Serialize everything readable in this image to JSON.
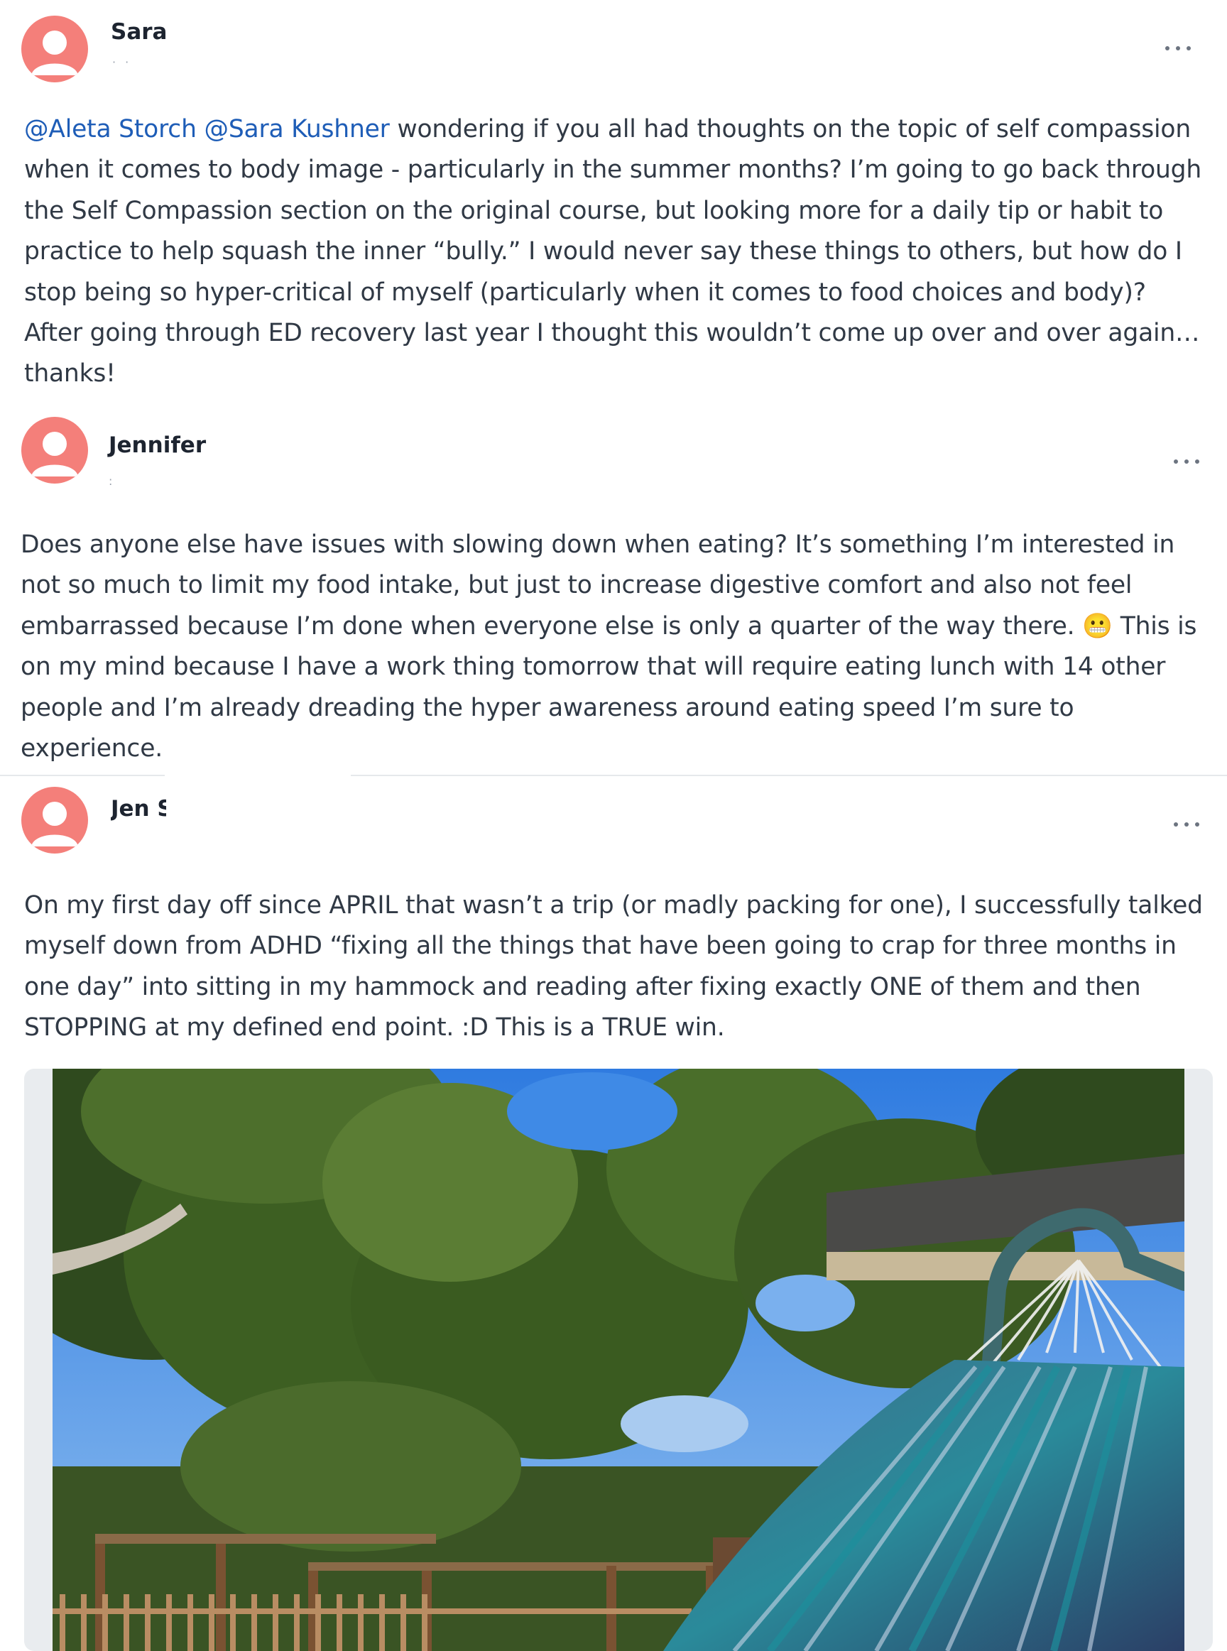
{
  "posts": [
    {
      "author": "Sara",
      "meta": "· ·",
      "avatar_icon": "user-avatar-icon",
      "more_icon": "more-options-icon",
      "mentions": [
        "@Aleta Storch",
        "@Sara Kushner"
      ],
      "text": "wondering if you all had thoughts on the topic of self compassion when it comes to body image - particularly in the summer months? I’m going to go back through the Self Compassion section on the original course, but looking more for a daily tip or habit to practice to help squash the inner “bully.” I would never say these things to others, but how do I stop being so hyper-critical of myself (particularly when it comes to food choices and body)? After going through ED recovery last year I thought this wouldn’t come up over and over again…thanks!"
    },
    {
      "author": "Jennifer",
      "meta": ":",
      "avatar_icon": "user-avatar-icon",
      "more_icon": "more-options-icon",
      "text_before_emoji": "Does anyone else have issues with slowing down when eating? It’s something I’m interested in not so much to limit my food intake, but just to increase digestive comfort and also not feel embarrassed because I’m done when everyone else is only a quarter of the way there.",
      "emoji": "😬",
      "text_after_emoji": "This is on my mind because I have a work thing tomorrow that will require eating lunch with 14 other people and I’m already dreading the hyper awareness around eating speed I’m sure to experience."
    },
    {
      "author": "Jen S",
      "avatar_icon": "user-avatar-icon",
      "more_icon": "more-options-icon",
      "text": "On my first day off since APRIL that wasn’t a trip (or madly packing for one), I successfully talked myself down from ADHD “fixing all the things that have been going to crap for three months in one day” into sitting in my hammock and reading after fixing exactly ONE of them and then STOPPING at my defined end point.  :D This is a TRUE win.",
      "image": "hammock-garden-photo"
    }
  ],
  "colors": {
    "mention": "#1e5db7",
    "avatar": "#f47f7a",
    "body_text": "#303945",
    "divider": "#e6e8eb"
  }
}
